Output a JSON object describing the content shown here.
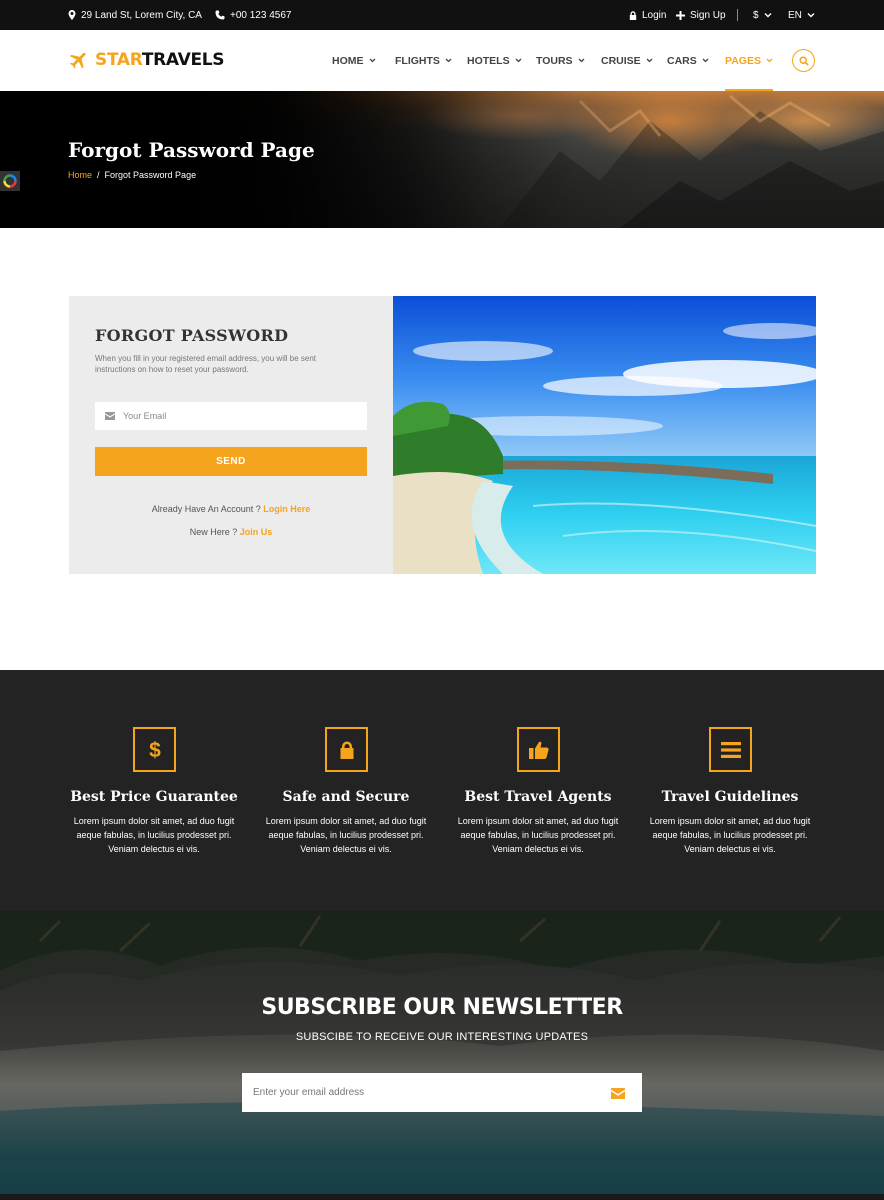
{
  "topbar": {
    "address": "29 Land St, Lorem City, CA",
    "phone": "+00 123 4567",
    "login": "Login",
    "signup": "Sign Up",
    "currency": "$",
    "language": "EN"
  },
  "header": {
    "logo_star": "STAR",
    "logo_travels": "TRAVELS",
    "nav": [
      {
        "label": "HOME"
      },
      {
        "label": "FLIGHTS"
      },
      {
        "label": "HOTELS"
      },
      {
        "label": "TOURS"
      },
      {
        "label": "CRUISE"
      },
      {
        "label": "CARS"
      },
      {
        "label": "PAGES",
        "active": true
      }
    ]
  },
  "hero": {
    "title": "Forgot Password Page",
    "breadcrumb_home": "Home",
    "breadcrumb_sep": "/",
    "breadcrumb_current": "Forgot Password Page"
  },
  "forgot": {
    "title": "FORGOT PASSWORD",
    "description": "When you fill in your registered email address, you will be sent instructions on how to reset your password.",
    "email_placeholder": "Your Email",
    "send_label": "SEND",
    "already_text": "Already Have An Account ? ",
    "login_link": "Login Here",
    "new_text": "New Here ? ",
    "join_link": "Join Us"
  },
  "features": [
    {
      "icon": "dollar-icon",
      "title": "Best Price Guarantee",
      "desc": "Lorem ipsum dolor sit amet, ad duo fugit aeque fabulas, in lucilius prodesset pri. Veniam delectus ei vis."
    },
    {
      "icon": "lock-icon",
      "title": "Safe and Secure",
      "desc": "Lorem ipsum dolor sit amet, ad duo fugit aeque fabulas, in lucilius prodesset pri. Veniam delectus ei vis."
    },
    {
      "icon": "thumbs-up-icon",
      "title": "Best Travel Agents",
      "desc": "Lorem ipsum dolor sit amet, ad duo fugit aeque fabulas, in lucilius prodesset pri. Veniam delectus ei vis."
    },
    {
      "icon": "list-icon",
      "title": "Travel Guidelines",
      "desc": "Lorem ipsum dolor sit amet, ad duo fugit aeque fabulas, in lucilius prodesset pri. Veniam delectus ei vis."
    }
  ],
  "newsletter": {
    "title": "SUBSCRIBE OUR NEWSLETTER",
    "subtitle": "SUBSCIBE TO RECEIVE OUR INTERESTING UPDATES",
    "placeholder": "Enter your email address"
  },
  "colors": {
    "accent": "#f5a41d",
    "dark": "#232323",
    "topbar": "#111111"
  }
}
